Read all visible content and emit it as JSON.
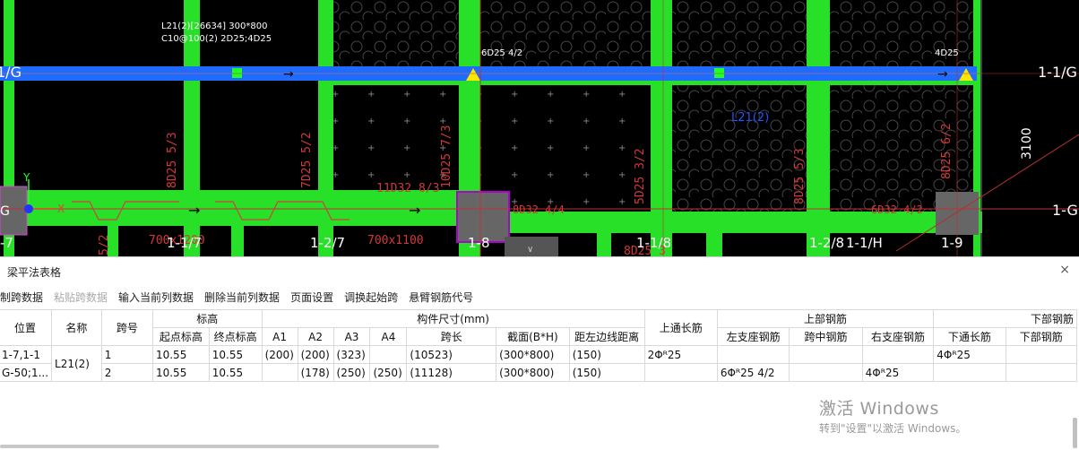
{
  "panel": {
    "title": "梁平法表格",
    "close_label": "×",
    "toolbar": [
      "制跨数据",
      "粘贴跨数据",
      "输入当前列数据",
      "删除当前列数据",
      "页面设置",
      "调换起始跨",
      "悬臂钢筋代号"
    ],
    "headers": {
      "position": "位置",
      "name": "名称",
      "span_no": "跨号",
      "elevation": "标高",
      "elev_start": "起点标高",
      "elev_end": "终点标高",
      "member_size": "构件尺寸(mm)",
      "a1": "A1",
      "a2": "A2",
      "a3": "A3",
      "a4": "A4",
      "span_len": "跨长",
      "section": "截面(B*H)",
      "offset": "距左边线距离",
      "top_through": "上通长筋",
      "top_rebar": "上部钢筋",
      "left_support": "左支座钢筋",
      "mid_span": "跨中钢筋",
      "right_support": "右支座钢筋",
      "bottom_rebar": "下部钢筋",
      "bottom_through": "下通长筋",
      "bottom_rebar2": "下部钢筋"
    },
    "rows": [
      {
        "position": "1-7,1-1",
        "name": "L21(2)",
        "span": "1",
        "elev_start": "10.55",
        "elev_end": "10.55",
        "a1": "(200)",
        "a2": "(200)",
        "a3": "(323)",
        "a4": "",
        "span_len": "(10523)",
        "section": "(300*800)",
        "offset": "(150)",
        "top_through": "2Φᴿ25",
        "left_support": "",
        "mid_span": "",
        "right_support": "",
        "bottom_through": "4Φᴿ25",
        "bottom": ""
      },
      {
        "position": "G-50;1...",
        "name": "",
        "span": "2",
        "elev_start": "10.55",
        "elev_end": "10.55",
        "a1": "",
        "a2": "(178)",
        "a3": "(250)",
        "a4": "(250)",
        "span_len": "(11128)",
        "section": "(300*800)",
        "offset": "(150)",
        "top_through": "",
        "left_support": "6Φᴿ25 4/2",
        "mid_span": "",
        "right_support": "4Φᴿ25",
        "bottom_through": "",
        "bottom": ""
      }
    ]
  },
  "watermark": {
    "line1": "激活 Windows",
    "line2": "转到\"设置\"以激活 Windows。"
  },
  "cad": {
    "annotations": {
      "beam_label_1": "L21(2)[26634] 300*800",
      "beam_label_2": "C10@100(2) 2D25;4D25",
      "top_6d25": "6D25 4/2",
      "top_4d25": "4D25",
      "axis_1g_right": "1-1/G",
      "axis_1g_left": "1/G",
      "axis_g_left": "G",
      "axis_1g2": "1-G",
      "dim_3100": "3100",
      "x_label": "X",
      "y_label": "Y",
      "l21": "L21(2)",
      "d8d25_1": "8D25 5/3",
      "d7d25": "7D25 5/2",
      "d11d32": "11D32 8/3",
      "d10d25": "10D25 7/3",
      "d5d25": "5D25 3/2",
      "d8d25_2": "8D25 5/3",
      "d8d25_3": "8D25 6/2",
      "d8d32": "8D32 4/4",
      "d6d32": "6D32 4/2",
      "s700_1": "700x1200",
      "s700_2": "700x1100",
      "ax_117": "1-1/7",
      "ax_127": "1-2/7",
      "ax_18": "1-8",
      "ax_118": "1-1/8",
      "ax_128": "1-2/8",
      "ax_11h": "1-1/H",
      "ax_19": "1-9",
      "ax_7": "-7",
      "d52": "5/2",
      "d8d25_4": "8D25 3"
    }
  }
}
